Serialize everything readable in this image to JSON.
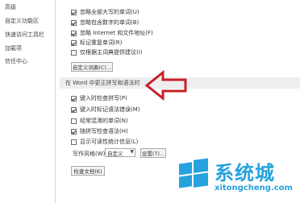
{
  "sidebar": {
    "items": [
      {
        "label": "高级"
      },
      {
        "label": "自定义功能区"
      },
      {
        "label": "快速访问工具栏"
      },
      {
        "label": "加载项"
      },
      {
        "label": "信任中心"
      }
    ]
  },
  "proofing": {
    "options": [
      {
        "label": "忽略全部大写的单词(U)",
        "checked": true
      },
      {
        "label": "忽略包含数字的单词(B)",
        "checked": true
      },
      {
        "label": "忽略 Internet 和文件地址(F)",
        "checked": true
      },
      {
        "label": "标记重复单词(R)",
        "checked": true
      },
      {
        "label": "仅根据主词典提供建议(I)",
        "checked": false
      }
    ],
    "custom_dict_button": "自定义词典(C)..."
  },
  "word_section": {
    "header": "在 Word 中更正拼写和语法时",
    "options": [
      {
        "label": "键入时检查拼写(P)",
        "checked": true
      },
      {
        "label": "键入时标记语法错误(M)",
        "checked": true
      },
      {
        "label": "经常混淆的单词(N)",
        "checked": false
      },
      {
        "label": "随拼写检查语法(H)",
        "checked": true
      },
      {
        "label": "显示可读性统计信息(L)",
        "checked": false
      }
    ],
    "writing_style_label": "写作风格(W):",
    "writing_style_value": "自定义",
    "settings_button": "设置(T)...",
    "check_doc_button": "检查文档(K)"
  },
  "watermark": {
    "title": "系统城",
    "url": "xitongcheng.com"
  },
  "colors": {
    "arrow": "#c8202a",
    "watermark": "#26a2dc"
  }
}
